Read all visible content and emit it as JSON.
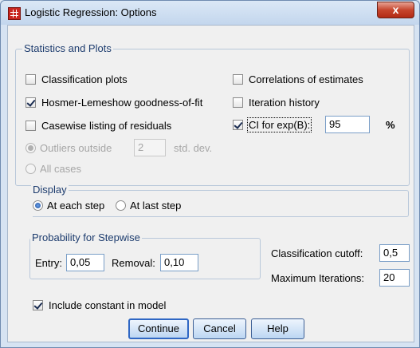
{
  "window": {
    "title": "Logistic Regression: Options",
    "close_label": "x"
  },
  "stats_group": {
    "legend": "Statistics and Plots",
    "classification_plots": {
      "label": "Classification plots",
      "checked": false
    },
    "hosmer_lemeshow": {
      "label": "Hosmer-Lemeshow goodness-of-fit",
      "checked": true
    },
    "casewise_listing": {
      "label": "Casewise listing of residuals",
      "checked": false
    },
    "outliers_outside": {
      "label": "Outliers outside",
      "value": "2",
      "unit": "std. dev.",
      "selected": true,
      "disabled": true
    },
    "all_cases": {
      "label": "All cases",
      "selected": false,
      "disabled": true
    },
    "correlations": {
      "label": "Correlations of estimates",
      "checked": false
    },
    "iteration_history": {
      "label": "Iteration history",
      "checked": false
    },
    "ci_exp_b": {
      "label": "CI for exp(B):",
      "checked": true,
      "value": "95",
      "unit": "%"
    }
  },
  "display_group": {
    "legend": "Display",
    "at_each_step": {
      "label": "At each step",
      "selected": true
    },
    "at_last_step": {
      "label": "At last step",
      "selected": false
    }
  },
  "stepwise_group": {
    "legend": "Probability for Stepwise",
    "entry": {
      "label": "Entry:",
      "value": "0,05"
    },
    "removal": {
      "label": "Removal:",
      "value": "0,10"
    }
  },
  "classification_cutoff": {
    "label": "Classification cutoff:",
    "value": "0,5"
  },
  "maximum_iterations": {
    "label": "Maximum Iterations:",
    "value": "20"
  },
  "include_constant": {
    "label": "Include constant in model",
    "checked": true
  },
  "buttons": {
    "continue": "Continue",
    "cancel": "Cancel",
    "help": "Help"
  },
  "colors": {
    "accent": "#2f67c4",
    "close": "#c6452d",
    "legend_text": "#1d3c6e"
  }
}
